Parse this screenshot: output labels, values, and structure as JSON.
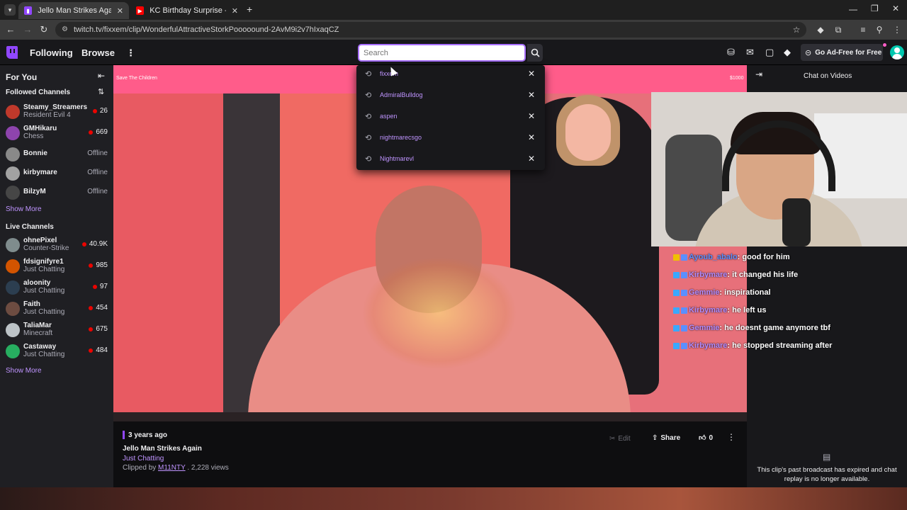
{
  "browser": {
    "tabs": [
      {
        "label": "Jello Man Strikes Again - Twitch",
        "active": true
      },
      {
        "label": "KC Birthday Surprise - YouTube",
        "active": false
      }
    ],
    "url": "twitch.tv/fixxem/clip/WonderfulAttractiveStorkPooooound-2AvM9i2v7hIxaqCZ"
  },
  "topnav": {
    "following": "Following",
    "browse": "Browse",
    "go_ad_free": "Go Ad-Free for Free"
  },
  "search": {
    "placeholder": "Search",
    "history": [
      "fixxem",
      "AdmiralBulldog",
      "aspen",
      "nightmarecsgo",
      "Nightmarevl"
    ]
  },
  "sidebar": {
    "for_you": "For You",
    "followed_header": "Followed Channels",
    "followed": [
      {
        "name": "Steamy_Streamers",
        "game": "Resident Evil 4",
        "viewers": "26",
        "color": "#c0392b"
      },
      {
        "name": "GMHikaru",
        "game": "Chess",
        "viewers": "669",
        "color": "#8e44ad"
      },
      {
        "name": "Bonnie",
        "game": "",
        "status": "Offline",
        "color": "#7f8c8d"
      },
      {
        "name": "kirbymare",
        "game": "",
        "status": "Offline",
        "color": "#95a5a6"
      },
      {
        "name": "BilzyM",
        "game": "",
        "status": "Offline",
        "color": "#34495e"
      }
    ],
    "show_more": "Show More",
    "live_header": "Live Channels",
    "live": [
      {
        "name": "ohnePixel",
        "game": "Counter-Strike",
        "viewers": "40.9K",
        "color": "#7f8c8d"
      },
      {
        "name": "fdsignifyre1",
        "game": "Just Chatting",
        "viewers": "985",
        "color": "#d35400"
      },
      {
        "name": "aloonity",
        "game": "Just Chatting",
        "viewers": "97",
        "color": "#2c3e50"
      },
      {
        "name": "Faith",
        "game": "Just Chatting",
        "viewers": "454",
        "color": "#6d4c41"
      },
      {
        "name": "TaliaMar",
        "game": "Minecraft",
        "viewers": "675",
        "color": "#bdc3c7"
      },
      {
        "name": "Castaway",
        "game": "Just Chatting",
        "viewers": "484",
        "color": "#27ae60"
      }
    ],
    "show_more_2": "Show More"
  },
  "video": {
    "banner_left": "Save The Children",
    "banner_right": "$1000"
  },
  "clip": {
    "age": "3 years ago",
    "title": "Jello Man Strikes Again",
    "category": "Just Chatting",
    "clipped_by_prefix": "Clipped by",
    "clipper": "M11NTY",
    "views": " . 2,228 views",
    "edit": "Edit",
    "share": "Share",
    "likes": "0"
  },
  "chat": {
    "header": "Chat on Videos",
    "lines": [
      {
        "user": "Ayoub_abalo",
        "msg": "good for him",
        "color": "#5b8fff"
      },
      {
        "user": "Kirbymare",
        "msg": "it changed his life",
        "color": "#b28cff"
      },
      {
        "user": "Gemmie",
        "msg": "inspirational",
        "color": "#b28cff"
      },
      {
        "user": "Kirbymare",
        "msg": "he left us",
        "color": "#b28cff"
      },
      {
        "user": "Gemmie",
        "msg": "he doesnt game anymore tbf",
        "color": "#b28cff"
      },
      {
        "user": "Kirbymare",
        "msg": "he stopped streaming after",
        "color": "#b28cff"
      }
    ],
    "expired_msg": "This clip's past broadcast has expired and chat replay is no longer available."
  },
  "colors": {
    "accent": "#9147ff",
    "live": "#eb0400",
    "link": "#bf94ff"
  }
}
